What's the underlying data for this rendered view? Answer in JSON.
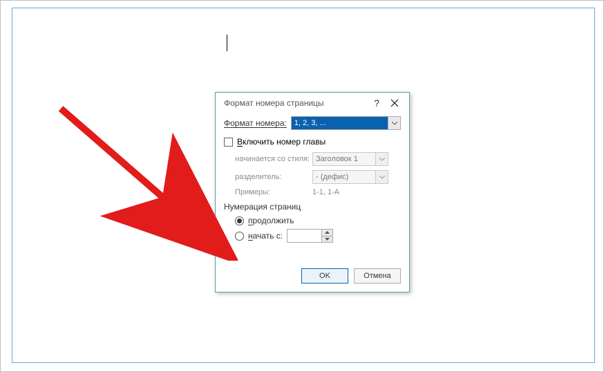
{
  "dialog_title": "Формат номера страницы",
  "format": {
    "label": "Формат номера:",
    "value": "1, 2, 3, ..."
  },
  "include_chapter": {
    "label": "Включить номер главы",
    "checked": false,
    "starts_with_style_label": "начинается со стиля:",
    "starts_with_style_value": "Заголовок 1",
    "separator_label": "разделитель:",
    "separator_value": "-    (дефис)",
    "examples_label": "Примеры:",
    "examples_value": "1-1, 1-A"
  },
  "page_numbering": {
    "group_label": "Нумерация страниц",
    "continue_label": "продолжить",
    "start_at_label": "начать с:",
    "start_at_value": ""
  },
  "buttons": {
    "ok": "OK",
    "cancel": "Отмена"
  }
}
